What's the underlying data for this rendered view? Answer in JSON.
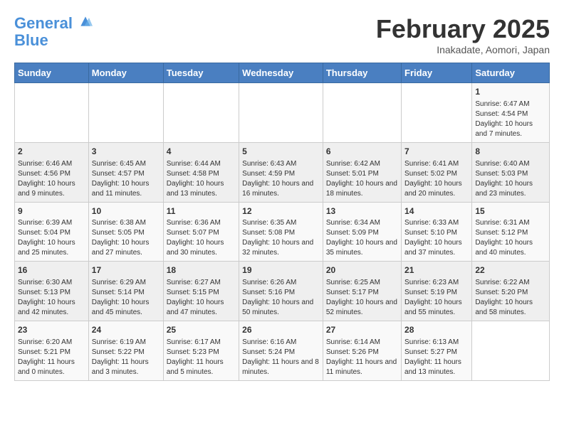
{
  "header": {
    "logo_line1": "General",
    "logo_line2": "Blue",
    "month": "February 2025",
    "location": "Inakadate, Aomori, Japan"
  },
  "weekdays": [
    "Sunday",
    "Monday",
    "Tuesday",
    "Wednesday",
    "Thursday",
    "Friday",
    "Saturday"
  ],
  "weeks": [
    [
      {
        "day": "",
        "info": ""
      },
      {
        "day": "",
        "info": ""
      },
      {
        "day": "",
        "info": ""
      },
      {
        "day": "",
        "info": ""
      },
      {
        "day": "",
        "info": ""
      },
      {
        "day": "",
        "info": ""
      },
      {
        "day": "1",
        "info": "Sunrise: 6:47 AM\nSunset: 4:54 PM\nDaylight: 10 hours and 7 minutes."
      }
    ],
    [
      {
        "day": "2",
        "info": "Sunrise: 6:46 AM\nSunset: 4:56 PM\nDaylight: 10 hours and 9 minutes."
      },
      {
        "day": "3",
        "info": "Sunrise: 6:45 AM\nSunset: 4:57 PM\nDaylight: 10 hours and 11 minutes."
      },
      {
        "day": "4",
        "info": "Sunrise: 6:44 AM\nSunset: 4:58 PM\nDaylight: 10 hours and 13 minutes."
      },
      {
        "day": "5",
        "info": "Sunrise: 6:43 AM\nSunset: 4:59 PM\nDaylight: 10 hours and 16 minutes."
      },
      {
        "day": "6",
        "info": "Sunrise: 6:42 AM\nSunset: 5:01 PM\nDaylight: 10 hours and 18 minutes."
      },
      {
        "day": "7",
        "info": "Sunrise: 6:41 AM\nSunset: 5:02 PM\nDaylight: 10 hours and 20 minutes."
      },
      {
        "day": "8",
        "info": "Sunrise: 6:40 AM\nSunset: 5:03 PM\nDaylight: 10 hours and 23 minutes."
      }
    ],
    [
      {
        "day": "9",
        "info": "Sunrise: 6:39 AM\nSunset: 5:04 PM\nDaylight: 10 hours and 25 minutes."
      },
      {
        "day": "10",
        "info": "Sunrise: 6:38 AM\nSunset: 5:05 PM\nDaylight: 10 hours and 27 minutes."
      },
      {
        "day": "11",
        "info": "Sunrise: 6:36 AM\nSunset: 5:07 PM\nDaylight: 10 hours and 30 minutes."
      },
      {
        "day": "12",
        "info": "Sunrise: 6:35 AM\nSunset: 5:08 PM\nDaylight: 10 hours and 32 minutes."
      },
      {
        "day": "13",
        "info": "Sunrise: 6:34 AM\nSunset: 5:09 PM\nDaylight: 10 hours and 35 minutes."
      },
      {
        "day": "14",
        "info": "Sunrise: 6:33 AM\nSunset: 5:10 PM\nDaylight: 10 hours and 37 minutes."
      },
      {
        "day": "15",
        "info": "Sunrise: 6:31 AM\nSunset: 5:12 PM\nDaylight: 10 hours and 40 minutes."
      }
    ],
    [
      {
        "day": "16",
        "info": "Sunrise: 6:30 AM\nSunset: 5:13 PM\nDaylight: 10 hours and 42 minutes."
      },
      {
        "day": "17",
        "info": "Sunrise: 6:29 AM\nSunset: 5:14 PM\nDaylight: 10 hours and 45 minutes."
      },
      {
        "day": "18",
        "info": "Sunrise: 6:27 AM\nSunset: 5:15 PM\nDaylight: 10 hours and 47 minutes."
      },
      {
        "day": "19",
        "info": "Sunrise: 6:26 AM\nSunset: 5:16 PM\nDaylight: 10 hours and 50 minutes."
      },
      {
        "day": "20",
        "info": "Sunrise: 6:25 AM\nSunset: 5:17 PM\nDaylight: 10 hours and 52 minutes."
      },
      {
        "day": "21",
        "info": "Sunrise: 6:23 AM\nSunset: 5:19 PM\nDaylight: 10 hours and 55 minutes."
      },
      {
        "day": "22",
        "info": "Sunrise: 6:22 AM\nSunset: 5:20 PM\nDaylight: 10 hours and 58 minutes."
      }
    ],
    [
      {
        "day": "23",
        "info": "Sunrise: 6:20 AM\nSunset: 5:21 PM\nDaylight: 11 hours and 0 minutes."
      },
      {
        "day": "24",
        "info": "Sunrise: 6:19 AM\nSunset: 5:22 PM\nDaylight: 11 hours and 3 minutes."
      },
      {
        "day": "25",
        "info": "Sunrise: 6:17 AM\nSunset: 5:23 PM\nDaylight: 11 hours and 5 minutes."
      },
      {
        "day": "26",
        "info": "Sunrise: 6:16 AM\nSunset: 5:24 PM\nDaylight: 11 hours and 8 minutes."
      },
      {
        "day": "27",
        "info": "Sunrise: 6:14 AM\nSunset: 5:26 PM\nDaylight: 11 hours and 11 minutes."
      },
      {
        "day": "28",
        "info": "Sunrise: 6:13 AM\nSunset: 5:27 PM\nDaylight: 11 hours and 13 minutes."
      },
      {
        "day": "",
        "info": ""
      }
    ]
  ]
}
